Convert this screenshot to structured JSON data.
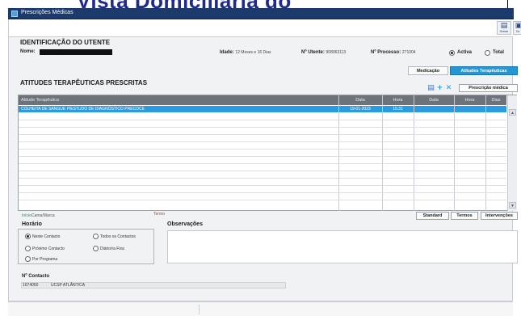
{
  "overlay": {
    "title": "Vista Domiciliária do"
  },
  "window": {
    "title": "Prescrições Médicas"
  },
  "toolbar": {
    "buttons": [
      {
        "label": "Gravar",
        "icon": "save-icon"
      },
      {
        "label": "Ca",
        "icon": "close-icon"
      }
    ]
  },
  "patient": {
    "section_title": "IDENTIFICAÇÃO DO UTENTE",
    "name_label": "Nome:",
    "age_label": "Idade:",
    "age_value": "12 Meses e 16 Dias",
    "utente_label": "Nº Utente:",
    "utente_value": "908063113",
    "processo_label": "Nº Processo:",
    "processo_value": "271004",
    "filter_activa": "Activa",
    "filter_total": "Total"
  },
  "tabs": {
    "medicacao": "Medicação",
    "atitudes": "Atitudes Terapêuticas"
  },
  "atitudes": {
    "section_title": "ATITUDES TERAPÊUTICAS PRESCRITAS",
    "prescricao_button": "Prescrição médica",
    "icons": {
      "new": "new-document-icon",
      "add": "plus-icon",
      "delete": "delete-icon"
    },
    "columns": [
      "Atitude Terapêutica",
      "Data",
      "Hora",
      "Data",
      "Hora",
      "Dias"
    ],
    "rows": [
      {
        "atitude": "COLHEITA DE SANGUE P/ESTUDO DE DIAGNÓSTICO PRECOCE",
        "data": "19-01-2023",
        "hora": "15:31",
        "data2": "",
        "hora2": "",
        "dias": ""
      }
    ]
  },
  "legend": {
    "inicio": "Início",
    "inicio_desc": "Cama/Marca",
    "termo": "Termo"
  },
  "actions": {
    "standard": "Standard",
    "termos": "Termos",
    "intervencoes": "Intervenções"
  },
  "horario": {
    "title": "Horário",
    "options": [
      "Neste Contacto",
      "Todos os Contactos",
      "Próximo Contacto",
      "Diário/ra Fixa",
      "Por Programa"
    ]
  },
  "observacoes": {
    "title": "Observações"
  },
  "contacto": {
    "label": "Nº Contacto",
    "number": "1074050",
    "unit": "UCSP ATLÂNTICA"
  },
  "colors": {
    "titlebar": "#1c3a6b",
    "accent": "#2596d4",
    "selected_row": "#2a9be0",
    "header": "#6e737b"
  }
}
